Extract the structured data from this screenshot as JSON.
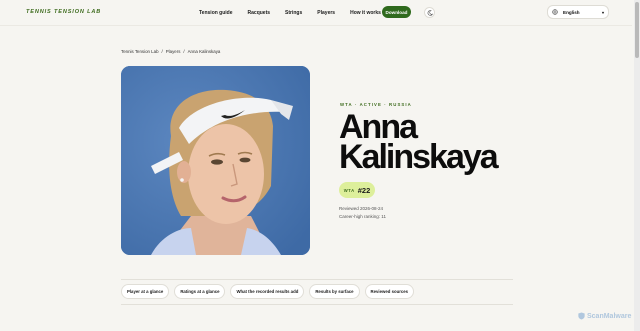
{
  "header": {
    "logo": "TENNIS TENSION LAB",
    "nav": [
      "Tension guide",
      "Racquets",
      "Strings",
      "Players",
      "How it works"
    ],
    "download_label": "Download",
    "language": "English"
  },
  "breadcrumb": {
    "items": [
      "Tennis Tension Lab",
      "Players",
      "Anna Kalinskaya"
    ],
    "separator": "/"
  },
  "player": {
    "meta": "WTA · ACTIVE · RUSSIA",
    "first_name": "Anna",
    "last_name": "Kalinskaya",
    "tour": "WTA",
    "rank": "#22",
    "reviewed": "Reviewed 2026-08-24",
    "career_high": "Career-high ranking: 11"
  },
  "tabs": [
    "Player at a glance",
    "Ratings at a glance",
    "What the recorded results add",
    "Results by surface",
    "Reviewed sources"
  ],
  "watermark": "ScanMalware",
  "colors": {
    "brand": "#3d6b1d",
    "download_bg": "#2f6a1d",
    "rank_pill_bg": "#ddef9b",
    "page_bg": "#f6f5f1",
    "photo_bg": "#4a77b2"
  }
}
